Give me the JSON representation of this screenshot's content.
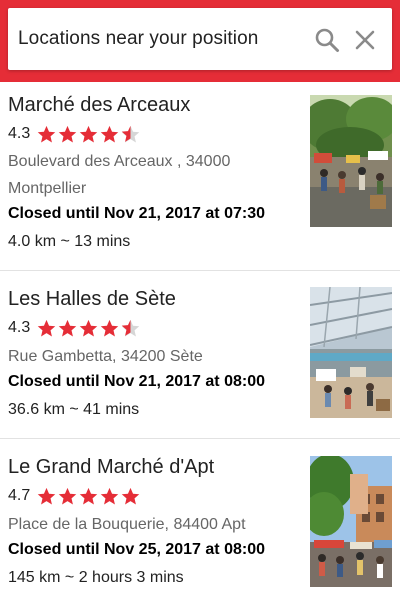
{
  "search": {
    "text": "Locations near your position",
    "search_icon": "search-icon",
    "close_icon": "close-icon"
  },
  "accent_color": "#e52d37",
  "star_color": "#e52d37",
  "places": [
    {
      "name": "Marché des Arceaux",
      "rating": "4.3",
      "stars": 4.5,
      "address": "Boulevard des Arceaux , 34000 Montpellier",
      "hours": "Closed until Nov 21, 2017 at 07:30",
      "distance": "4.0 km ~ 13 mins",
      "thumbnail": "outdoor-market-photo"
    },
    {
      "name": "Les Halles de Sète",
      "rating": "4.3",
      "stars": 4.5,
      "address": "Rue Gambetta, 34200 Sète",
      "hours": "Closed until Nov 21, 2017 at 08:00",
      "distance": "36.6 km ~ 41 mins",
      "thumbnail": "covered-market-photo"
    },
    {
      "name": "Le Grand Marché d'Apt",
      "rating": "4.7",
      "stars": 5,
      "address": "Place de la Bouquerie, 84400 Apt",
      "hours": "Closed until Nov 25, 2017 at 08:00",
      "distance": "145 km ~ 2 hours 3 mins",
      "thumbnail": "town-market-photo"
    }
  ]
}
